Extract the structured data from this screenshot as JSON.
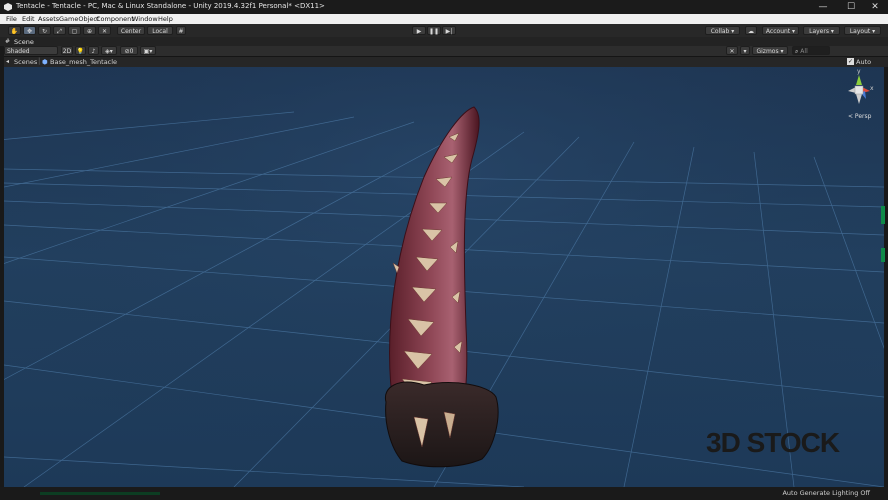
{
  "window": {
    "title": "Tentacle - Tentacle - PC, Mac & Linux Standalone - Unity 2019.4.32f1 Personal* <DX11>",
    "controls": [
      "—",
      "☐",
      "✕"
    ]
  },
  "menu": [
    "File",
    "Edit",
    "Assets",
    "GameObject",
    "Component",
    "Window",
    "Help"
  ],
  "toolbar": {
    "pivot_label": "Center",
    "space_label": "Local",
    "collab_label": "Collab ▾",
    "account_label": "Account ▾",
    "layers_label": "Layers ▾",
    "layout_label": "Layout ▾"
  },
  "scene_tab": {
    "label": "Scene"
  },
  "scene_toolbar": {
    "shading_mode": "Shaded",
    "mode_2d": "2D",
    "gizmos_label": "Gizmos ▾",
    "search_placeholder": "All",
    "layer_count": "0"
  },
  "breadcrumb": {
    "root": "Scenes",
    "item": "Base_mesh_Tentacle",
    "auto_save_label": "Auto Save",
    "auto_save_checked": true
  },
  "gizmo": {
    "axis_y": "y",
    "axis_x": "x",
    "persp_label": "< Persp"
  },
  "watermark": {
    "brand": "3D STOCK"
  },
  "status": {
    "text": "Auto Generate Lighting Off"
  },
  "colors": {
    "sky": "#1f3a5a",
    "grid": "#4d7aa6",
    "accent_green": "#0f8a49"
  }
}
